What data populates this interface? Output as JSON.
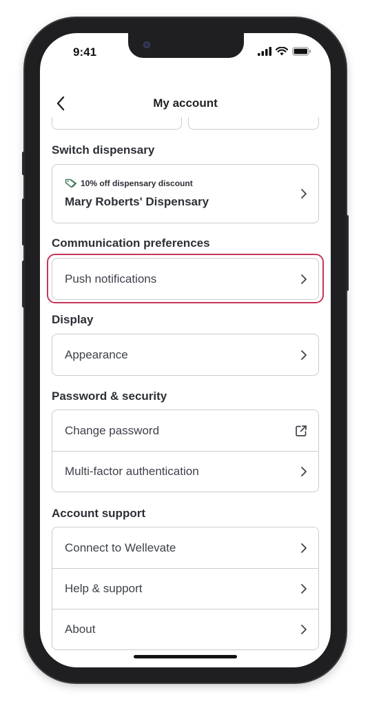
{
  "status_bar": {
    "time": "9:41"
  },
  "header": {
    "title": "My account"
  },
  "sections": {
    "switch_dispensary": {
      "title": "Switch dispensary",
      "discount": "10% off dispensary discount",
      "dispensary_name": "Mary Roberts' Dispensary"
    },
    "communication": {
      "title": "Communication preferences",
      "push_notifications": "Push notifications"
    },
    "display": {
      "title": "Display",
      "appearance": "Appearance"
    },
    "password_security": {
      "title": "Password & security",
      "change_password": "Change password",
      "mfa": "Multi-factor authentication"
    },
    "account_support": {
      "title": "Account support",
      "connect": "Connect to Wellevate",
      "help": "Help & support",
      "about": "About"
    }
  },
  "colors": {
    "highlight": "#c7335a",
    "border": "#c9cbd1",
    "text": "#3d4149"
  }
}
